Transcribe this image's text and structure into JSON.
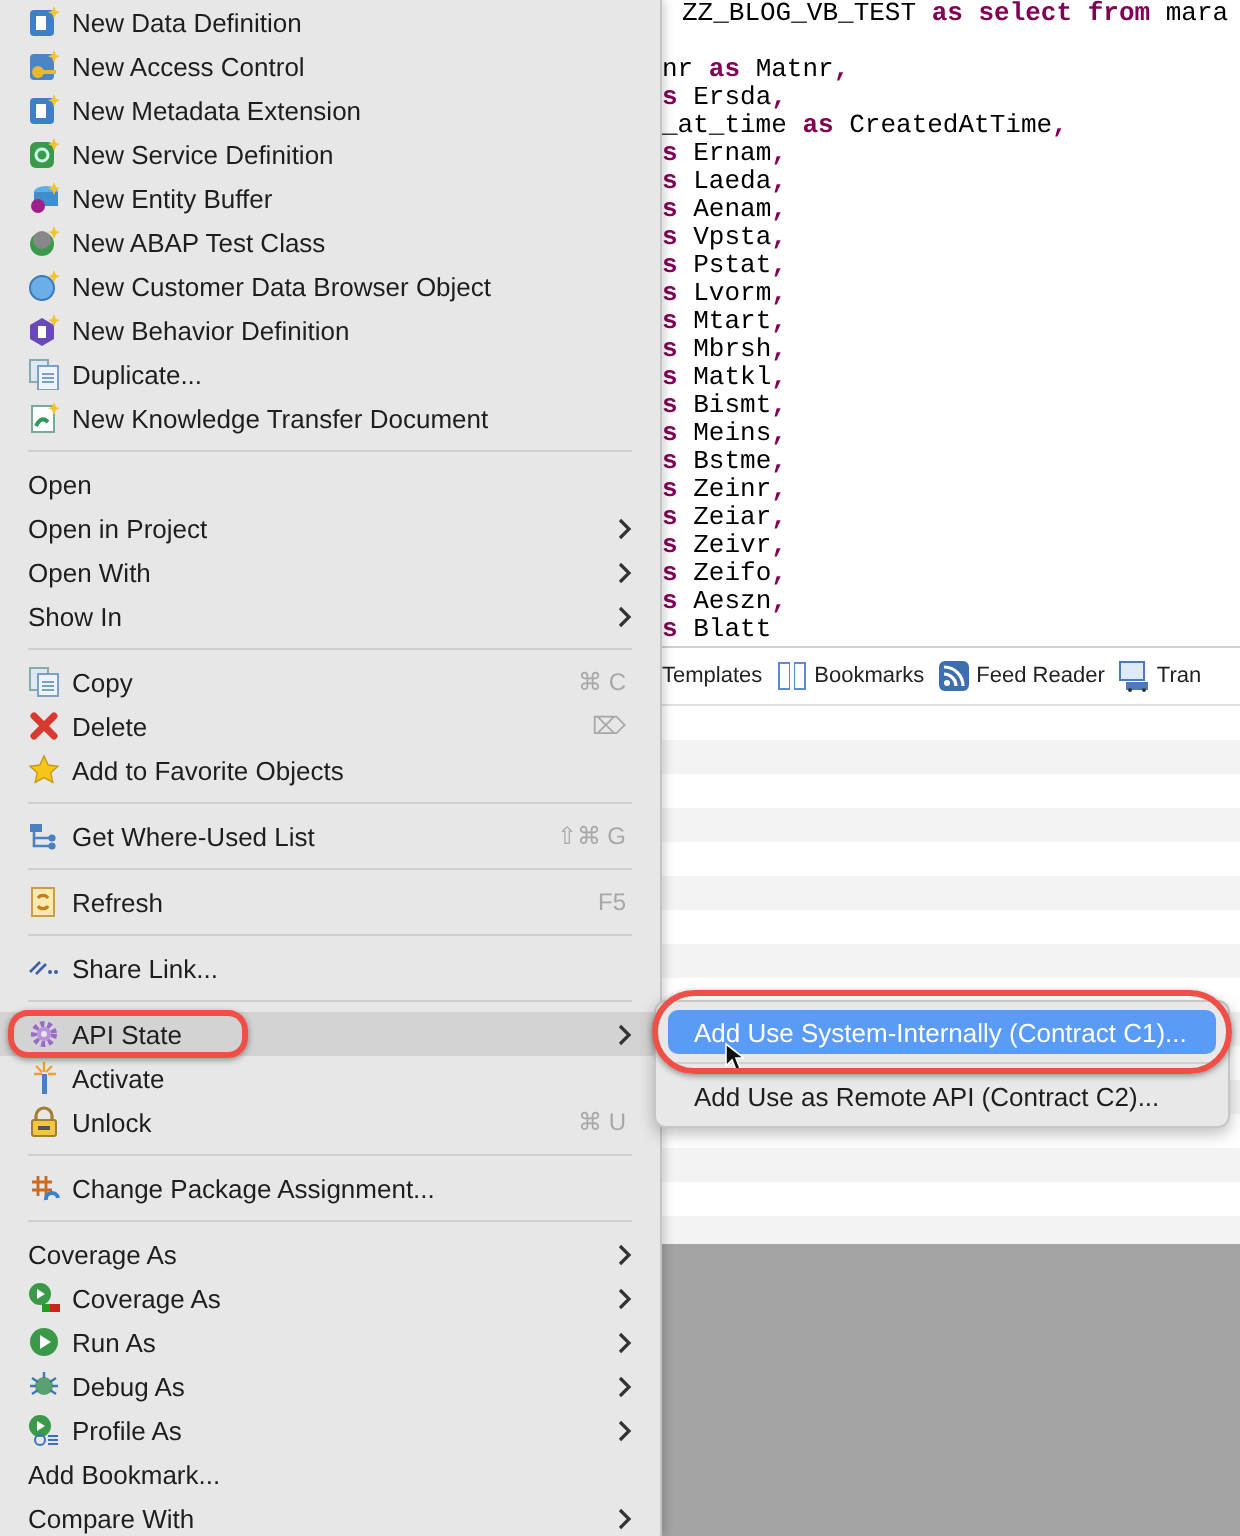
{
  "editor": {
    "lines": [
      [
        {
          "text": "ZZ_BLOG_VB_TEST ",
          "kind": "ident"
        },
        {
          "text": "as select from",
          "kind": "keyword"
        },
        {
          "text": " mara",
          "kind": "ident"
        }
      ],
      [
        {
          "text": "nr ",
          "kind": "ident",
          "gap_before": true
        },
        {
          "text": "as",
          "kind": "keyword"
        },
        {
          "text": " Matnr",
          "kind": "ident"
        },
        {
          "text": ",",
          "kind": "keyword"
        }
      ],
      [
        {
          "text": "s",
          "kind": "keyword"
        },
        {
          "text": " Ersda",
          "kind": "ident"
        },
        {
          "text": ",",
          "kind": "keyword"
        }
      ],
      [
        {
          "text": "_at_time ",
          "kind": "ident"
        },
        {
          "text": "as",
          "kind": "keyword"
        },
        {
          "text": " CreatedAtTime",
          "kind": "ident"
        },
        {
          "text": ",",
          "kind": "keyword"
        }
      ],
      [
        {
          "text": "s",
          "kind": "keyword"
        },
        {
          "text": " Ernam",
          "kind": "ident"
        },
        {
          "text": ",",
          "kind": "keyword"
        }
      ],
      [
        {
          "text": "s",
          "kind": "keyword"
        },
        {
          "text": " Laeda",
          "kind": "ident"
        },
        {
          "text": ",",
          "kind": "keyword"
        }
      ],
      [
        {
          "text": "s",
          "kind": "keyword"
        },
        {
          "text": " Aenam",
          "kind": "ident"
        },
        {
          "text": ",",
          "kind": "keyword"
        }
      ],
      [
        {
          "text": "s",
          "kind": "keyword"
        },
        {
          "text": " Vpsta",
          "kind": "ident"
        },
        {
          "text": ",",
          "kind": "keyword"
        }
      ],
      [
        {
          "text": "s",
          "kind": "keyword"
        },
        {
          "text": " Pstat",
          "kind": "ident"
        },
        {
          "text": ",",
          "kind": "keyword"
        }
      ],
      [
        {
          "text": "s",
          "kind": "keyword"
        },
        {
          "text": " Lvorm",
          "kind": "ident"
        },
        {
          "text": ",",
          "kind": "keyword"
        }
      ],
      [
        {
          "text": "s",
          "kind": "keyword"
        },
        {
          "text": " Mtart",
          "kind": "ident"
        },
        {
          "text": ",",
          "kind": "keyword"
        }
      ],
      [
        {
          "text": "s",
          "kind": "keyword"
        },
        {
          "text": " Mbrsh",
          "kind": "ident"
        },
        {
          "text": ",",
          "kind": "keyword"
        }
      ],
      [
        {
          "text": "s",
          "kind": "keyword"
        },
        {
          "text": " Matkl",
          "kind": "ident"
        },
        {
          "text": ",",
          "kind": "keyword"
        }
      ],
      [
        {
          "text": "s",
          "kind": "keyword"
        },
        {
          "text": " Bismt",
          "kind": "ident"
        },
        {
          "text": ",",
          "kind": "keyword"
        }
      ],
      [
        {
          "text": "s",
          "kind": "keyword"
        },
        {
          "text": " Meins",
          "kind": "ident"
        },
        {
          "text": ",",
          "kind": "keyword"
        }
      ],
      [
        {
          "text": "s",
          "kind": "keyword"
        },
        {
          "text": " Bstme",
          "kind": "ident"
        },
        {
          "text": ",",
          "kind": "keyword"
        }
      ],
      [
        {
          "text": "s",
          "kind": "keyword"
        },
        {
          "text": " Zeinr",
          "kind": "ident"
        },
        {
          "text": ",",
          "kind": "keyword"
        }
      ],
      [
        {
          "text": "s",
          "kind": "keyword"
        },
        {
          "text": " Zeiar",
          "kind": "ident"
        },
        {
          "text": ",",
          "kind": "keyword"
        }
      ],
      [
        {
          "text": "s",
          "kind": "keyword"
        },
        {
          "text": " Zeivr",
          "kind": "ident"
        },
        {
          "text": ",",
          "kind": "keyword"
        }
      ],
      [
        {
          "text": "s",
          "kind": "keyword"
        },
        {
          "text": " Zeifo",
          "kind": "ident"
        },
        {
          "text": ",",
          "kind": "keyword"
        }
      ],
      [
        {
          "text": "s",
          "kind": "keyword"
        },
        {
          "text": " Aeszn",
          "kind": "ident"
        },
        {
          "text": ",",
          "kind": "keyword"
        }
      ],
      [
        {
          "text": "s",
          "kind": "keyword"
        },
        {
          "text": " Blatt",
          "kind": "ident"
        }
      ]
    ]
  },
  "view_tabs": [
    {
      "label": "Templates",
      "icon": false
    },
    {
      "label": "Bookmarks",
      "icon": true
    },
    {
      "label": "Feed Reader",
      "icon": true
    },
    {
      "label": "Tran",
      "icon": true
    }
  ],
  "menu": {
    "items": [
      {
        "kind": "item",
        "label": "New Data Definition",
        "icon": true,
        "submenu": false,
        "selected": false,
        "outlined": false
      },
      {
        "kind": "item",
        "label": "New Access Control",
        "icon": true,
        "submenu": false,
        "selected": false,
        "outlined": false
      },
      {
        "kind": "item",
        "label": "New Metadata Extension",
        "icon": true,
        "submenu": false,
        "selected": false,
        "outlined": false
      },
      {
        "kind": "item",
        "label": "New Service Definition",
        "icon": true,
        "submenu": false,
        "selected": false,
        "outlined": false
      },
      {
        "kind": "item",
        "label": "New Entity Buffer",
        "icon": true,
        "submenu": false,
        "selected": false,
        "outlined": false
      },
      {
        "kind": "item",
        "label": "New ABAP Test Class",
        "icon": true,
        "submenu": false,
        "selected": false,
        "outlined": false
      },
      {
        "kind": "item",
        "label": "New Customer Data Browser Object",
        "icon": true,
        "submenu": false,
        "selected": false,
        "outlined": false
      },
      {
        "kind": "item",
        "label": "New Behavior Definition",
        "icon": true,
        "submenu": false,
        "selected": false,
        "outlined": false
      },
      {
        "kind": "item",
        "label": "Duplicate...",
        "icon": true,
        "submenu": false,
        "selected": false,
        "outlined": false
      },
      {
        "kind": "item",
        "label": "New Knowledge Transfer Document",
        "icon": true,
        "submenu": false,
        "selected": false,
        "outlined": false
      },
      {
        "kind": "separator"
      },
      {
        "kind": "item",
        "label": "Open",
        "icon": false,
        "submenu": false,
        "selected": false,
        "outlined": false
      },
      {
        "kind": "item",
        "label": "Open in Project",
        "icon": false,
        "submenu": true,
        "selected": false,
        "outlined": false
      },
      {
        "kind": "item",
        "label": "Open With",
        "icon": false,
        "submenu": true,
        "selected": false,
        "outlined": false
      },
      {
        "kind": "item",
        "label": "Show In",
        "icon": false,
        "submenu": true,
        "selected": false,
        "outlined": false
      },
      {
        "kind": "separator"
      },
      {
        "kind": "item",
        "label": "Copy",
        "icon": true,
        "shortcut": "⌘ C",
        "submenu": false,
        "selected": false,
        "outlined": false
      },
      {
        "kind": "item",
        "label": "Delete",
        "icon": true,
        "shortcut": "⌦",
        "submenu": false,
        "selected": false,
        "outlined": false
      },
      {
        "kind": "item",
        "label": "Add to Favorite Objects",
        "icon": true,
        "submenu": false,
        "selected": false,
        "outlined": false
      },
      {
        "kind": "separator"
      },
      {
        "kind": "item",
        "label": "Get Where-Used List",
        "icon": true,
        "shortcut": "⇧⌘ G",
        "submenu": false,
        "selected": false,
        "outlined": false
      },
      {
        "kind": "separator"
      },
      {
        "kind": "item",
        "label": "Refresh",
        "icon": true,
        "shortcut": "F5",
        "submenu": false,
        "selected": false,
        "outlined": false
      },
      {
        "kind": "separator"
      },
      {
        "kind": "item",
        "label": "Share Link...",
        "icon": true,
        "submenu": false,
        "selected": false,
        "outlined": false
      },
      {
        "kind": "separator"
      },
      {
        "kind": "item",
        "label": "API State",
        "icon": true,
        "submenu": true,
        "selected": true,
        "outlined": true
      },
      {
        "kind": "item",
        "label": "Activate",
        "icon": true,
        "submenu": false,
        "selected": false,
        "outlined": false
      },
      {
        "kind": "item",
        "label": "Unlock",
        "icon": true,
        "shortcut": "⌘ U",
        "submenu": false,
        "selected": false,
        "outlined": false
      },
      {
        "kind": "separator"
      },
      {
        "kind": "item",
        "label": "Change Package Assignment...",
        "icon": true,
        "submenu": false,
        "selected": false,
        "outlined": false
      },
      {
        "kind": "separator"
      },
      {
        "kind": "item",
        "label": "Coverage As",
        "icon": false,
        "submenu": true,
        "selected": false,
        "outlined": false
      },
      {
        "kind": "item",
        "label": "Coverage As",
        "icon": true,
        "submenu": true,
        "selected": false,
        "outlined": false
      },
      {
        "kind": "item",
        "label": "Run As",
        "icon": true,
        "submenu": true,
        "selected": false,
        "outlined": false
      },
      {
        "kind": "item",
        "label": "Debug As",
        "icon": true,
        "submenu": true,
        "selected": false,
        "outlined": false
      },
      {
        "kind": "item",
        "label": "Profile As",
        "icon": true,
        "submenu": true,
        "selected": false,
        "outlined": false
      },
      {
        "kind": "item",
        "label": "Add Bookmark...",
        "icon": false,
        "submenu": false,
        "selected": false,
        "outlined": false
      },
      {
        "kind": "item",
        "label": "Compare With",
        "icon": false,
        "submenu": true,
        "selected": false,
        "outlined": false
      }
    ]
  },
  "submenu": {
    "items": [
      {
        "kind": "item",
        "label": "Add Use System-Internally (Contract C1)...",
        "selected": true,
        "outlined": true
      },
      {
        "kind": "separator"
      },
      {
        "kind": "item",
        "label": "Add Use as Remote API (Contract C2)...",
        "selected": false,
        "outlined": false
      }
    ]
  }
}
